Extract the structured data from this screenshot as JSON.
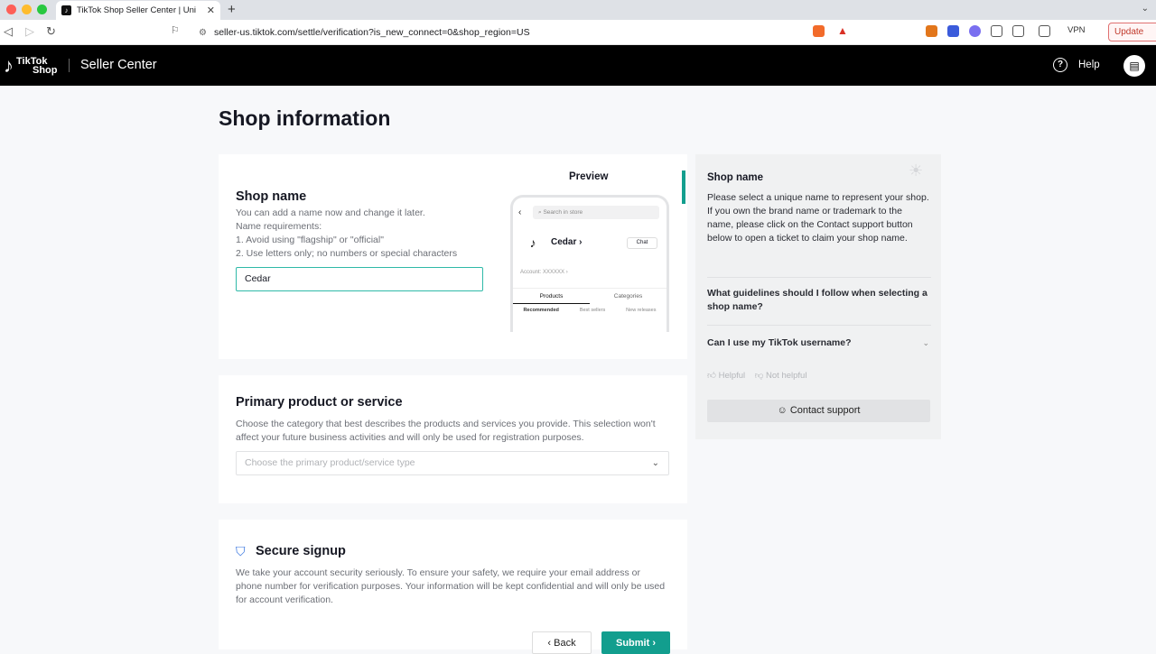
{
  "browser": {
    "tab_title": "TikTok Shop Seller Center | Uni",
    "url": "seller-us.tiktok.com/settle/verification?is_new_connect=0&shop_region=US",
    "vpn_label": "VPN",
    "update_label": "Update"
  },
  "header": {
    "logo_top": "TikTok",
    "logo_bottom": "Shop",
    "title": "Seller Center",
    "help_label": "Help"
  },
  "page": {
    "title": "Shop information"
  },
  "shop_name": {
    "title": "Shop name",
    "desc1": "You can add a name now and change it later.",
    "desc2": "Name requirements:",
    "req1": "1. Avoid using \"flagship\" or \"official\"",
    "req2": "2. Use letters only; no numbers or special characters",
    "value": "Cedar"
  },
  "preview": {
    "label": "Preview",
    "search_placeholder": "Search in store",
    "shop_name": "Cedar",
    "chat": "Chat",
    "account": "Account: XXXXXX",
    "tabs": [
      "Products",
      "Categories"
    ],
    "subtabs": [
      "Recommended",
      "Best sellers",
      "New releases"
    ]
  },
  "primary": {
    "title": "Primary product or service",
    "desc": "Choose the category that best describes the products and services you provide. This selection won't affect your future business activities and will only be used for registration purposes.",
    "placeholder": "Choose the primary product/service type"
  },
  "secure": {
    "title": "Secure signup",
    "desc": "We take your account security seriously. To ensure your safety, we require your email address or phone number for verification purposes. Your information will be kept confidential and will only be used for account verification."
  },
  "buttons": {
    "back": "Back",
    "submit": "Submit"
  },
  "side_panel": {
    "title": "Shop name",
    "desc1": "Please select a unique name to represent your shop.",
    "desc2": "If you own the brand name or trademark to the name, please click on the Contact support button below to open a ticket to claim your shop name.",
    "faq1": "What guidelines should I follow when selecting a shop name?",
    "faq2": "Can I use my TikTok username?",
    "helpful": "Helpful",
    "not_helpful": "Not helpful",
    "contact": "Contact support"
  },
  "colors": {
    "accent": "#129e8e",
    "header_bg": "#000000"
  }
}
